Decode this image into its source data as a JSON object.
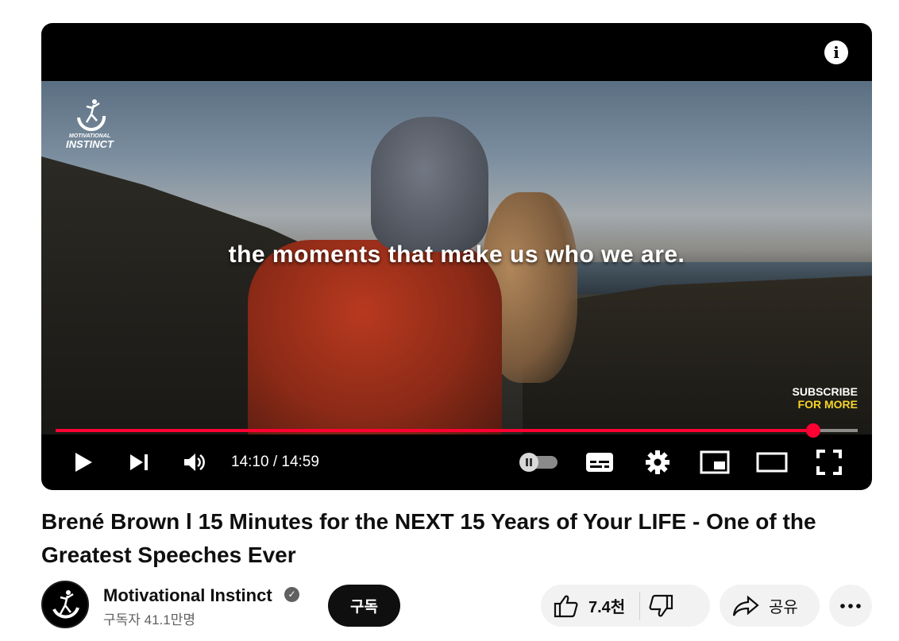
{
  "player": {
    "caption": "the moments that make us who we are.",
    "watermark_small": "MOTIVATIONAL",
    "watermark_large": "INSTINCT",
    "corner_line1": "SUBSCRIBE",
    "corner_line2": "FOR MORE",
    "info_glyph": "i",
    "time_display": "14:10 / 14:59",
    "progress_fraction": 0.945,
    "progress_color": "#ff0033",
    "corner_line1_color": "#ffffff",
    "corner_line2_color": "#f5d52a"
  },
  "icons": [
    "play-icon",
    "next-icon",
    "volume-icon",
    "autoplay-toggle-icon",
    "subtitles-icon",
    "settings-gear-icon",
    "miniplayer-icon",
    "theater-mode-icon",
    "fullscreen-icon",
    "thumbs-up-icon",
    "thumbs-down-icon",
    "share-icon",
    "more-icon",
    "verified-check-icon"
  ],
  "video": {
    "title": "Brené Brown l 15 Minutes for the NEXT 15 Years of Your LIFE - One of the Greatest Speeches Ever"
  },
  "channel": {
    "name": "Motivational Instinct",
    "subscribers": "구독자 41.1만명",
    "subscribe_label": "구독"
  },
  "actions": {
    "like_count": "7.4천",
    "share_label": "공유"
  }
}
